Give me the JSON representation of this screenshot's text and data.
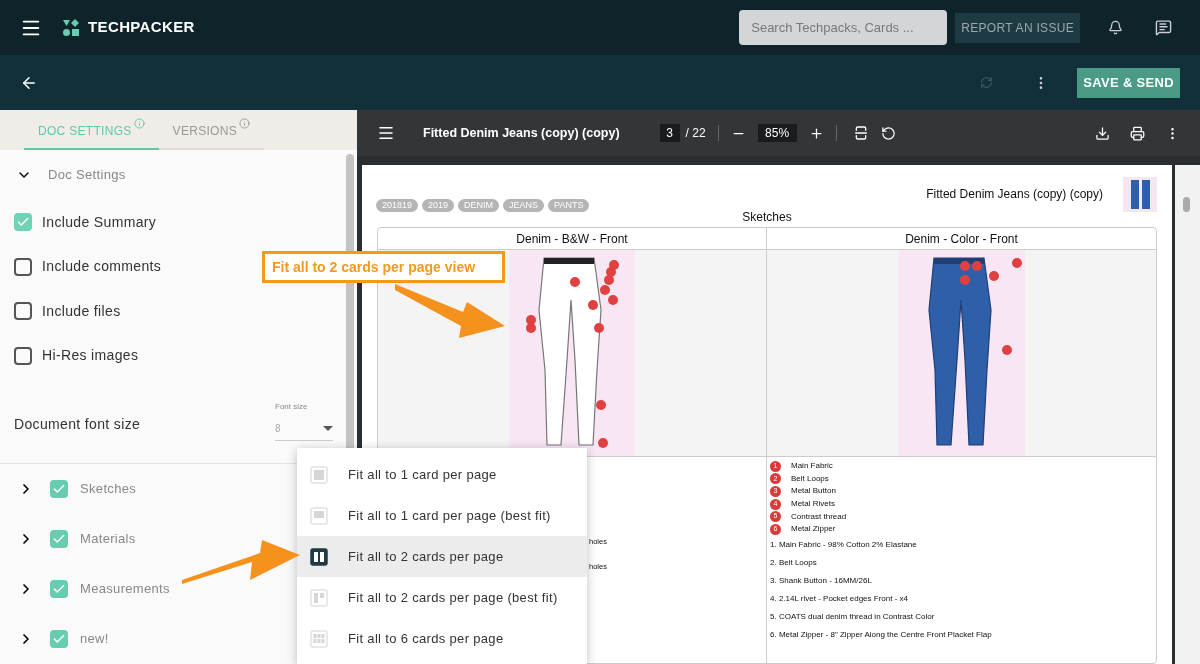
{
  "app": {
    "brand": "TECHPACKER",
    "search_placeholder": "Search Techpacks, Cards ...",
    "report_button": "REPORT AN ISSUE"
  },
  "action_bar": {
    "save_button": "SAVE & SEND"
  },
  "side_tabs": [
    {
      "label": "DOC SETTINGS",
      "selected": true
    },
    {
      "label": "VERSIONS",
      "selected": false
    }
  ],
  "doc_settings": {
    "title": "Doc Settings",
    "expanded": true,
    "options": [
      {
        "label": "Include Summary",
        "checked": true
      },
      {
        "label": "Include comments",
        "checked": false
      },
      {
        "label": "Include files",
        "checked": false
      },
      {
        "label": "Hi-Res images",
        "checked": false
      }
    ],
    "font_size": {
      "label": "Document font size",
      "field_label": "Font size",
      "value": "8"
    }
  },
  "sections": [
    {
      "label": "Sketches",
      "checked": true,
      "expanded": false
    },
    {
      "label": "Materials",
      "checked": true,
      "expanded": false
    },
    {
      "label": "Measurements",
      "checked": true,
      "expanded": false
    },
    {
      "label": "new!",
      "checked": true,
      "expanded": false
    }
  ],
  "viewer": {
    "title": "Fitted Denim Jeans (copy) (copy)",
    "page": "3",
    "page_count": "/ 22",
    "zoom": "85%"
  },
  "document": {
    "title": "Fitted Denim Jeans (copy) (copy)",
    "tags": [
      "201819",
      "2019",
      "DENIM",
      "JEANS",
      "PANTS"
    ],
    "section": "Sketches",
    "columns": [
      {
        "heading": "Denim - B&W - Front",
        "kind": "white"
      },
      {
        "heading": "Denim - Color - Front",
        "kind": "blue"
      }
    ],
    "left_notes": [
      "holes",
      "holes"
    ],
    "legend": [
      {
        "number": "1",
        "label": "Main Fabric"
      },
      {
        "number": "2",
        "label": "Belt Loops"
      },
      {
        "number": "3",
        "label": "Metal Button"
      },
      {
        "number": "4",
        "label": "Metal Rivets"
      },
      {
        "number": "5",
        "label": "Contrast thread"
      },
      {
        "number": "6",
        "label": "Metal Zipper"
      }
    ],
    "notes": [
      "1. Main Fabric - 98% Cotton 2% Elastane",
      "2. Belt Loops",
      "3. Shank Button - 16MM/26L",
      "4. 2.14L rivet - Pocket edges Front - x4",
      "5. COATS dual denim thread in Contrast Color",
      "6. Metal Zipper - 8\" Zipper Along the Centre Front Placket Flap"
    ]
  },
  "layout_menu": {
    "items": [
      {
        "label": "Fit all to 1 card per page",
        "kind": "single",
        "selected": false
      },
      {
        "label": "Fit all to 1 card per page (best fit)",
        "kind": "single-fit",
        "selected": false
      },
      {
        "label": "Fit all to 2 cards per page",
        "kind": "double",
        "selected": true
      },
      {
        "label": "Fit all to 2 cards per page (best fit)",
        "kind": "double-fit",
        "selected": false
      },
      {
        "label": "Fit all to 6 cards per page",
        "kind": "six",
        "selected": false
      }
    ]
  },
  "callout": {
    "text": "Fit all to 2 cards per page view"
  }
}
